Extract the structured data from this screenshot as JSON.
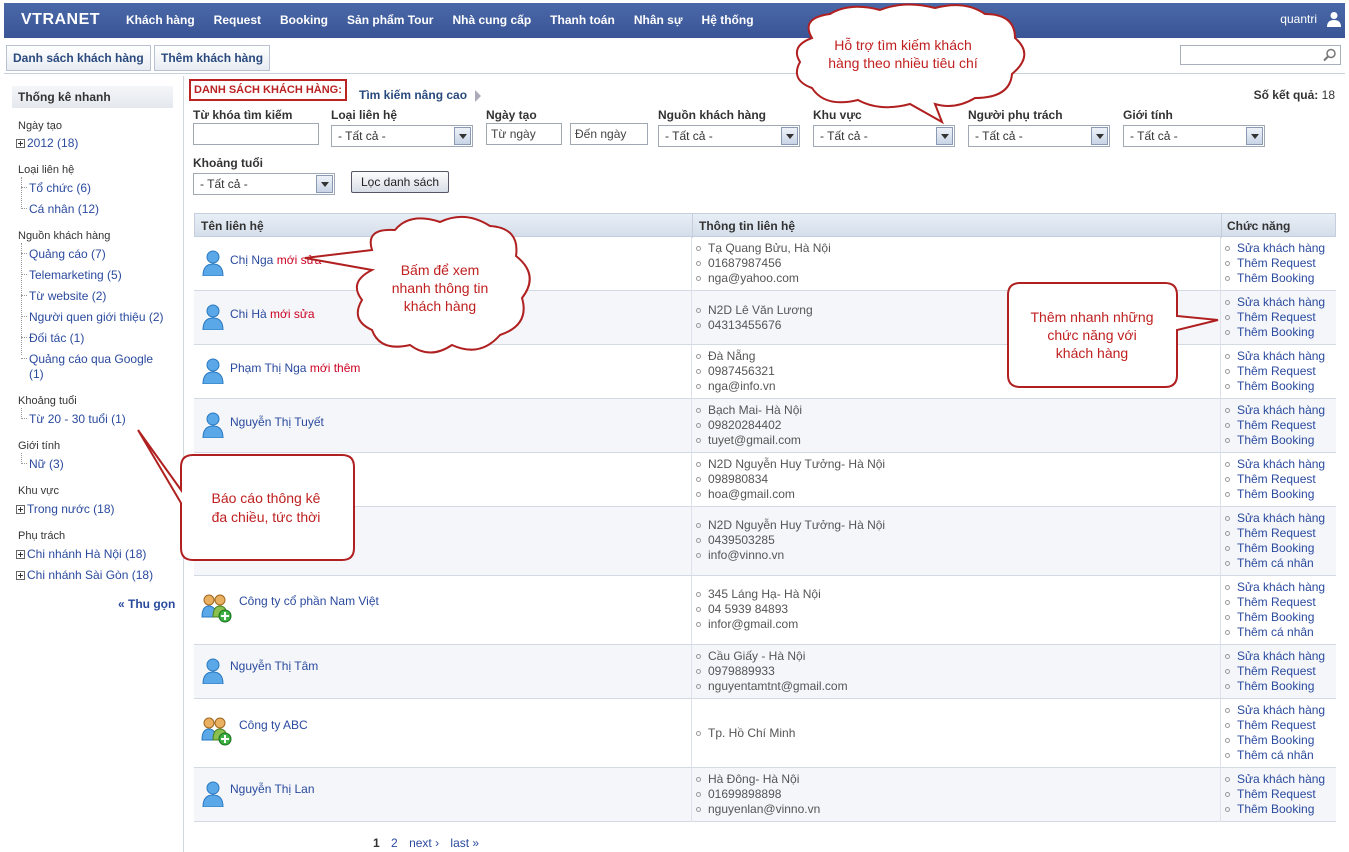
{
  "app": {
    "logo": "VTRANET",
    "username": "quantri"
  },
  "nav": [
    "Khách hàng",
    "Request",
    "Booking",
    "Sản phẩm Tour",
    "Nhà cung cấp",
    "Thanh toán",
    "Nhân sự",
    "Hệ thống"
  ],
  "subtabs": {
    "list": "Danh sách khách hàng",
    "add": "Thêm khách hàng"
  },
  "search": {
    "placeholder": ""
  },
  "sidebar": {
    "title": "Thống kê nhanh",
    "groups": [
      {
        "label": "Ngày tạo",
        "items": [
          "2012 (18)"
        ]
      },
      {
        "label": "Loại liên hệ",
        "items": [
          "Tổ chức (6)",
          "Cá nhân (12)"
        ]
      },
      {
        "label": "Nguồn khách hàng",
        "items": [
          "Quảng cáo (7)",
          "Telemarketing (5)",
          "Từ website (2)",
          "Người quen giới thiệu (2)",
          "Đối tác (1)",
          "Quảng cáo qua Google",
          "(1)"
        ]
      },
      {
        "label": "Khoảng tuổi",
        "items": [
          "Từ 20 - 30 tuổi (1)"
        ]
      },
      {
        "label": "Giới tính",
        "items": [
          "Nữ (3)"
        ]
      },
      {
        "label": "Khu vực",
        "items": [
          "Trong nước (18)"
        ]
      },
      {
        "label": "Phụ trách",
        "items": [
          "Chi nhánh Hà Nội (18)",
          "Chi nhánh Sài Gòn (18)"
        ]
      }
    ],
    "collapse": "« Thu gọn"
  },
  "header": {
    "list_label": "DANH SÁCH KHÁCH HÀNG:",
    "advanced": "Tìm kiếm nâng cao",
    "results_label": "Số kết quả:",
    "results_count": "18"
  },
  "filters": {
    "keyword": "Từ khóa tìm kiếm",
    "contact_type": "Loại liên hệ",
    "date": "Ngày tạo",
    "from_date": "Từ ngày",
    "to_date": "Đến ngày",
    "source": "Nguồn khách hàng",
    "region": "Khu vực",
    "owner": "Người phụ trách",
    "gender": "Giới tính",
    "age": "Khoảng tuổi",
    "all": "- Tất cả -",
    "submit": "Lọc danh sách"
  },
  "table": {
    "headers": [
      "Tên liên hệ",
      "Thông tin liên hệ",
      "Chức năng"
    ],
    "rows": [
      {
        "name": "Chị Nga",
        "tag": "mới sửa",
        "type": "person",
        "info": [
          "Tạ Quang Bửu, Hà Nội",
          "01687987456",
          "nga@yahoo.com"
        ],
        "actions": [
          "Sửa khách hàng",
          "Thêm Request",
          "Thêm Booking"
        ]
      },
      {
        "name": "Chi Hà",
        "tag": "mới sửa",
        "type": "person",
        "info": [
          "N2D Lê Văn Lương",
          "04313455676"
        ],
        "actions": [
          "Sửa khách hàng",
          "Thêm Request",
          "Thêm Booking"
        ]
      },
      {
        "name": "Phạm Thị Nga",
        "tag": "mới thêm",
        "type": "person",
        "info": [
          "Đà Nẵng",
          "0987456321",
          "nga@info.vn"
        ],
        "actions": [
          "Sửa khách hàng",
          "Thêm Request",
          "Thêm Booking"
        ]
      },
      {
        "name": "Nguyễn Thị Tuyết",
        "tag": "",
        "type": "person",
        "info": [
          "Bạch Mai- Hà Nội",
          "09820284402",
          "tuyet@gmail.com"
        ],
        "actions": [
          "Sửa khách hàng",
          "Thêm Request",
          "Thêm Booking"
        ]
      },
      {
        "name": "",
        "tag": "",
        "type": "none",
        "info": [
          "N2D Nguyễn Huy Tưởng- Hà Nội",
          "098980834",
          "hoa@gmail.com"
        ],
        "actions": [
          "Sửa khách hàng",
          "Thêm Request",
          "Thêm Booking"
        ]
      },
      {
        "name": "",
        "tag": "",
        "type": "none",
        "info": [
          "N2D Nguyễn Huy Tưởng- Hà Nội",
          "0439503285",
          "info@vinno.vn"
        ],
        "actions": [
          "Sửa khách hàng",
          "Thêm Request",
          "Thêm Booking",
          "Thêm cá nhân"
        ]
      },
      {
        "name": "Công ty cổ phần Nam Việt",
        "tag": "",
        "type": "org",
        "info": [
          "345 Láng Hạ- Hà Nội",
          "04 5939 84893",
          "infor@gmail.com"
        ],
        "actions": [
          "Sửa khách hàng",
          "Thêm Request",
          "Thêm Booking",
          "Thêm cá nhân"
        ]
      },
      {
        "name": "Nguyễn Thị Tâm",
        "tag": "",
        "type": "person",
        "info": [
          "Cầu Giấy - Hà Nội",
          "0979889933",
          "nguyentamtnt@gmail.com"
        ],
        "actions": [
          "Sửa khách hàng",
          "Thêm Request",
          "Thêm Booking"
        ]
      },
      {
        "name": "Công ty ABC",
        "tag": "",
        "type": "org",
        "info": [
          "Tp. Hồ Chí Minh"
        ],
        "actions": [
          "Sửa khách hàng",
          "Thêm Request",
          "Thêm Booking",
          "Thêm cá nhân"
        ]
      },
      {
        "name": "Nguyễn Thị Lan",
        "tag": "",
        "type": "person",
        "info": [
          "Hà Đông- Hà Nội",
          "01699898898",
          "nguyenlan@vinno.vn"
        ],
        "actions": [
          "Sửa khách hàng",
          "Thêm Request",
          "Thêm Booking"
        ]
      }
    ]
  },
  "pager": {
    "pages": [
      "1",
      "2"
    ],
    "next": "next ›",
    "last": "last »"
  },
  "callouts": {
    "search": [
      "Hỗ trợ tìm kiếm khách",
      "hàng theo nhiều tiêu chí"
    ],
    "view": [
      "Bấm để xem",
      "nhanh thông tin",
      "khách hàng"
    ],
    "actions": [
      "Thêm nhanh những",
      "chức năng với",
      "khách hàng"
    ],
    "report": [
      "Báo cáo thông kê",
      "đa chiều, tức thời"
    ]
  }
}
